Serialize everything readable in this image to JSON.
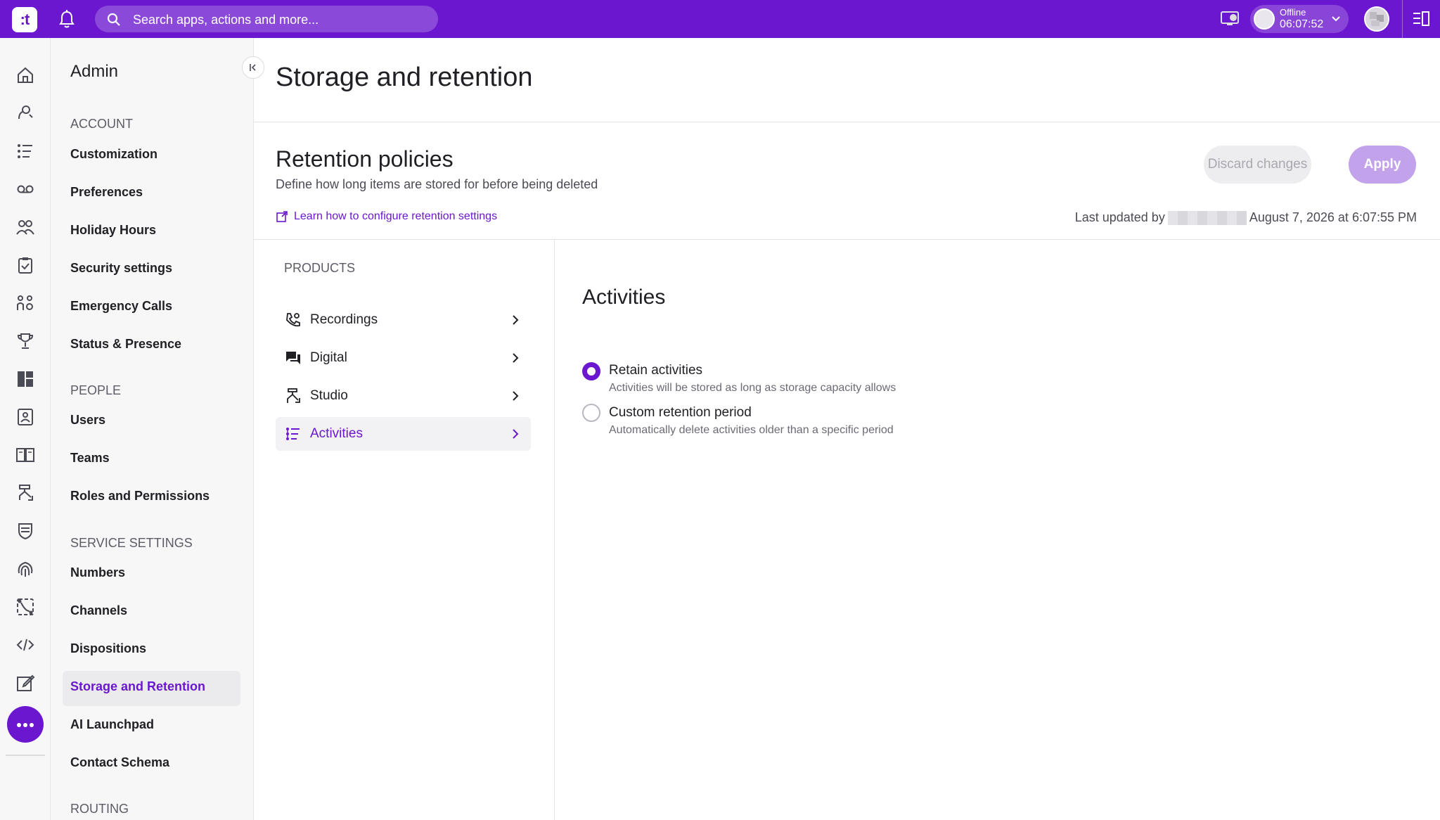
{
  "topbar": {
    "logo_text": ":t",
    "search_placeholder": "Search apps, actions and more...",
    "status_label": "Offline",
    "status_timer": "06:07:52"
  },
  "rail_icons": [
    "home-icon",
    "voice-icon",
    "activities-list-icon",
    "voicemail-icon",
    "people-icon",
    "clipboard-icon",
    "team-icon",
    "trophy-icon",
    "dashboard-icon",
    "contacts-icon",
    "book-icon",
    "studio-icon",
    "shield-icon",
    "fingerprint-icon",
    "workflow-icon",
    "code-icon",
    "edit-icon",
    "more-icon"
  ],
  "sidebar": {
    "title": "Admin",
    "sections": [
      {
        "label": "ACCOUNT",
        "items": [
          "Customization",
          "Preferences",
          "Holiday Hours",
          "Security settings",
          "Emergency Calls",
          "Status & Presence"
        ]
      },
      {
        "label": "PEOPLE",
        "items": [
          "Users",
          "Teams",
          "Roles and Permissions"
        ]
      },
      {
        "label": "SERVICE SETTINGS",
        "items": [
          "Numbers",
          "Channels",
          "Dispositions",
          "Storage and Retention",
          "AI Launchpad",
          "Contact Schema"
        ]
      },
      {
        "label": "ROUTING",
        "items": []
      }
    ],
    "active_item": "Storage and Retention"
  },
  "main": {
    "page_title": "Storage and retention",
    "section_title": "Retention policies",
    "section_subtitle": "Define how long items are stored for before being deleted",
    "help_link": "Learn how to configure retention settings",
    "discard_label": "Discard changes",
    "apply_label": "Apply",
    "updated_prefix": "Last updated by",
    "updated_date": "August 7, 2026 at 6:07:55 PM"
  },
  "products": {
    "label": "PRODUCTS",
    "items": [
      {
        "label": "Recordings",
        "icon": "phone-recording-icon"
      },
      {
        "label": "Digital",
        "icon": "chat-icon"
      },
      {
        "label": "Studio",
        "icon": "studio-icon"
      },
      {
        "label": "Activities",
        "icon": "activities-list-icon"
      }
    ],
    "active": "Activities"
  },
  "activities": {
    "title": "Activities",
    "options": [
      {
        "label": "Retain activities",
        "description": "Activities will be stored as long as storage capacity allows",
        "checked": true
      },
      {
        "label": "Custom retention period",
        "description": "Automatically delete activities older than a specific period",
        "checked": false
      }
    ]
  },
  "colors": {
    "brand": "#6b17cf",
    "apply_disabled": "#c3a2ec"
  }
}
